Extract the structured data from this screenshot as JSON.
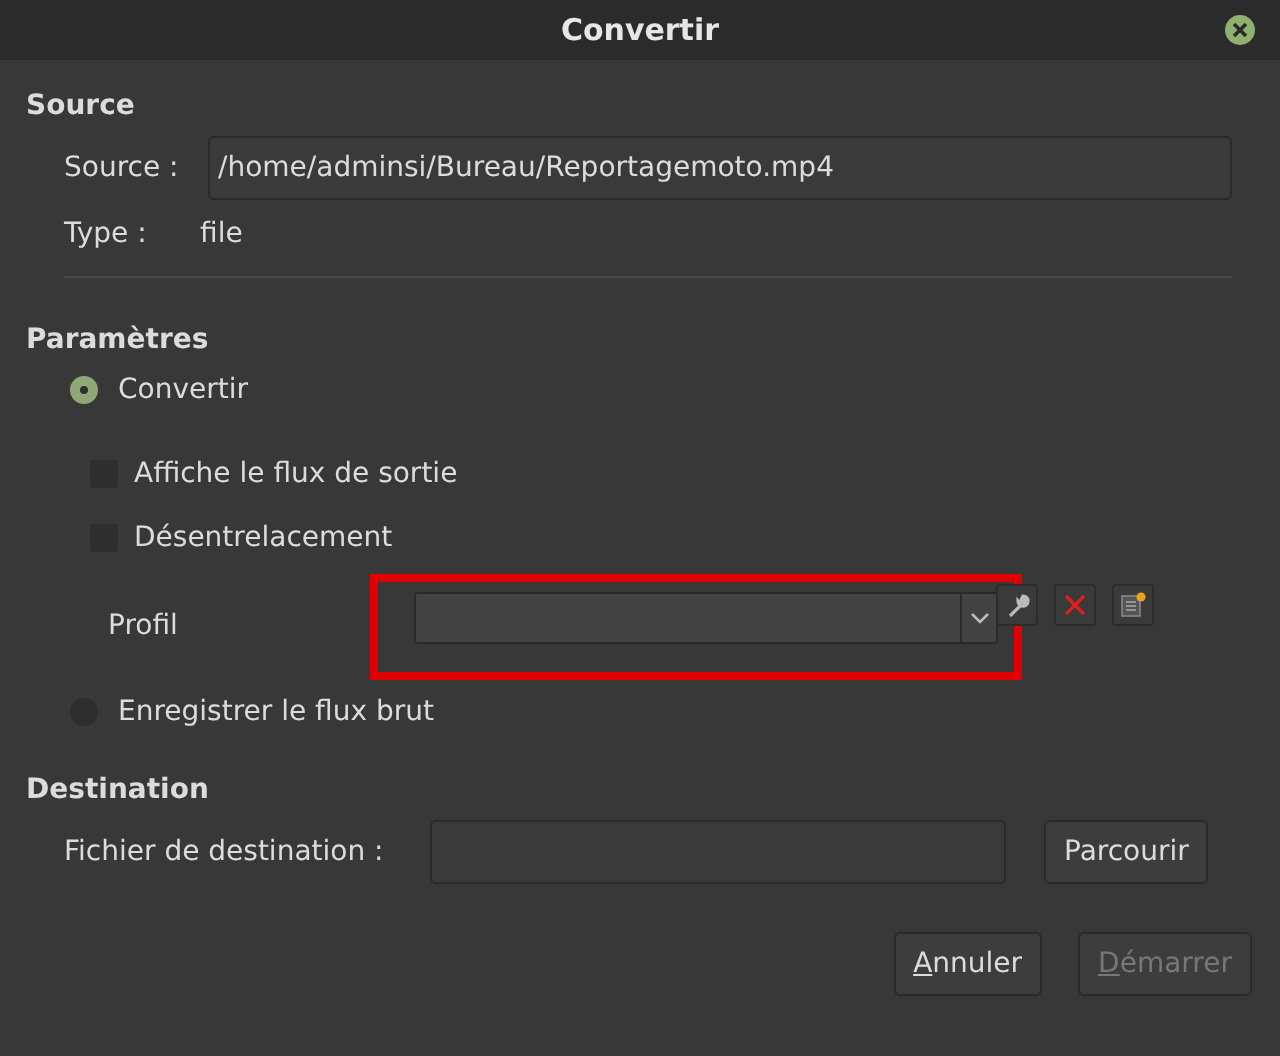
{
  "window": {
    "title": "Convertir"
  },
  "source": {
    "heading": "Source",
    "source_label": "Source :",
    "source_value": "/home/adminsi/Bureau/Reportagemoto.mp4",
    "type_label": "Type :",
    "type_value": "file"
  },
  "settings": {
    "heading": "Paramètres",
    "convert_option": {
      "label": "Convertir",
      "selected": true
    },
    "options": [
      {
        "label": "Affiche le flux de sortie",
        "checked": false
      },
      {
        "label": "Désentrelacement",
        "checked": false
      }
    ],
    "profile": {
      "label": "Profil",
      "highlighted": true
    },
    "raw_option": {
      "label": "Enregistrer le flux brut",
      "selected": false
    }
  },
  "destination": {
    "heading": "Destination",
    "label": "Fichier de destination :",
    "browse": "Parcourir"
  },
  "buttons": [
    {
      "label": "Annuler",
      "mnemonic_underlined": true,
      "disabled": false
    },
    {
      "label": "Démarrer",
      "mnemonic_underlined": true,
      "disabled": true
    }
  ]
}
